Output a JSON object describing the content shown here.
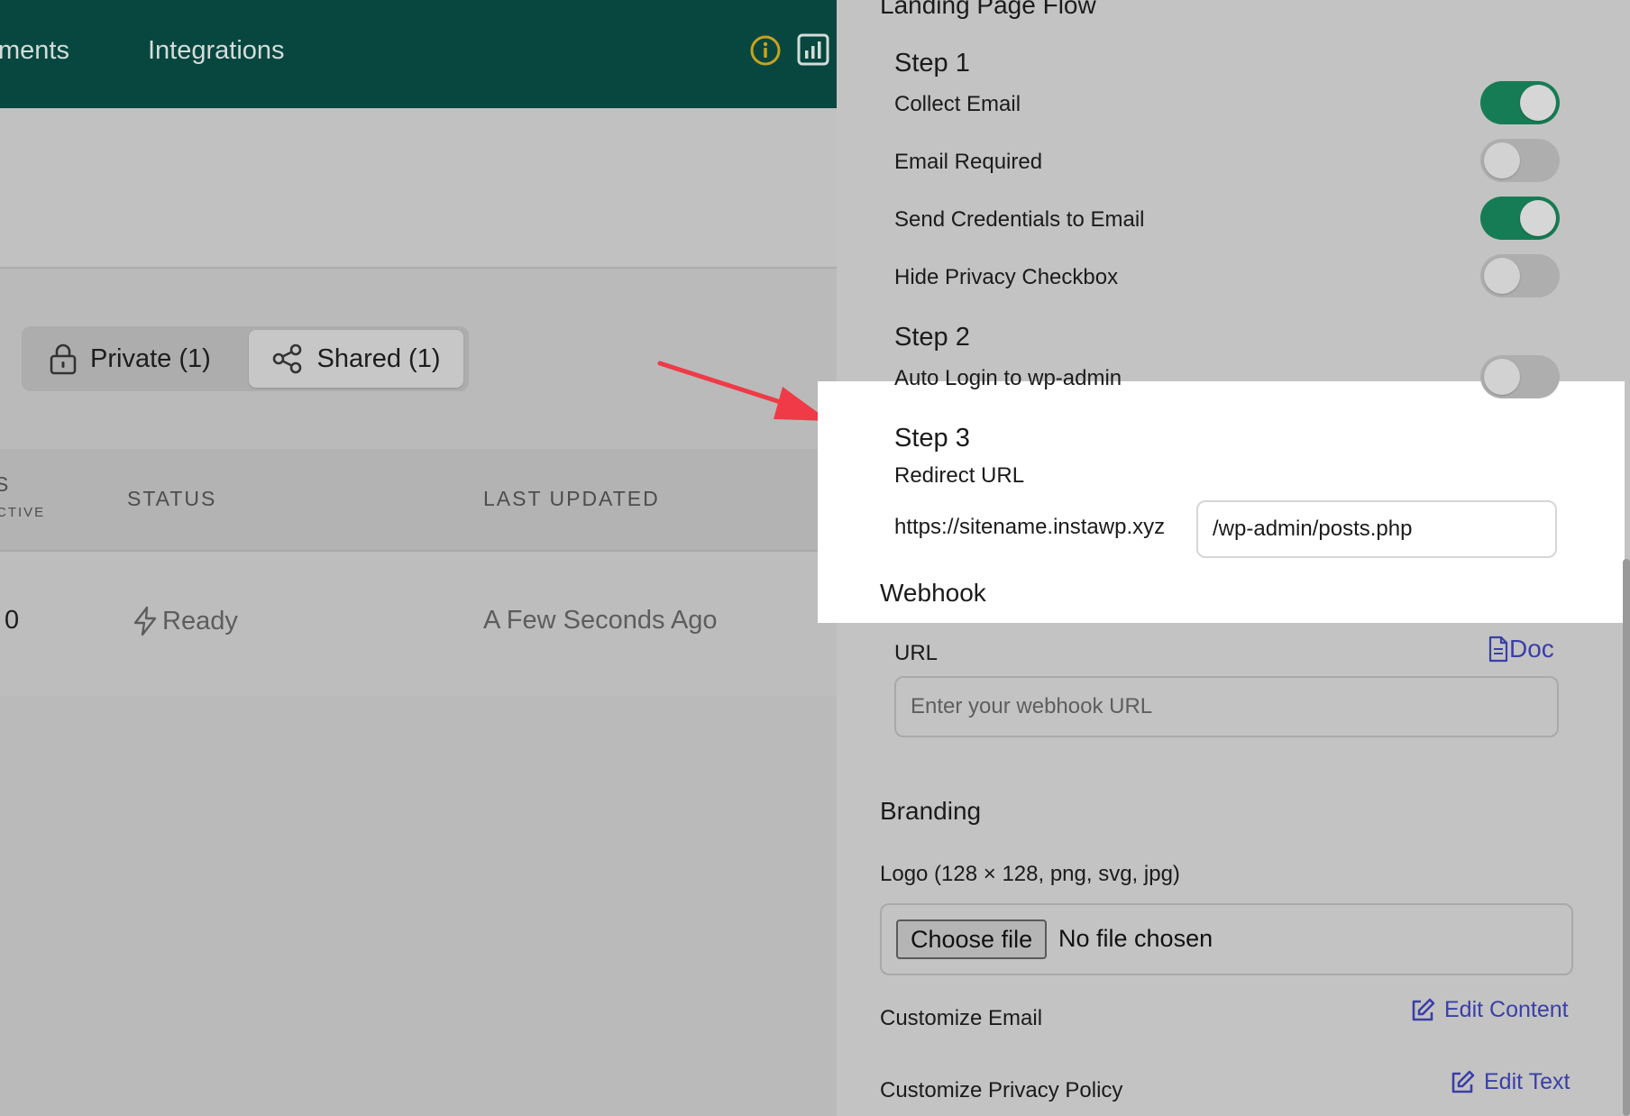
{
  "nav": {
    "items": [
      {
        "label": "ments"
      },
      {
        "label": "Integrations"
      }
    ]
  },
  "tabs": {
    "private": "Private (1)",
    "shared": "Shared (1)"
  },
  "table": {
    "headers": {
      "partial_s": "S",
      "partial_ctive": "CTIVE",
      "status": "STATUS",
      "last_updated": "LAST UPDATED"
    },
    "row": {
      "count": "0",
      "status": "Ready",
      "last_updated": "A Few Seconds Ago"
    }
  },
  "drawer": {
    "landing_title": "Landing Page Flow",
    "step1": {
      "title": "Step 1",
      "options": [
        {
          "label": "Collect Email",
          "on": true
        },
        {
          "label": "Email Required",
          "on": false
        },
        {
          "label": "Send Credentials to Email",
          "on": true
        },
        {
          "label": "Hide Privacy Checkbox",
          "on": false
        }
      ]
    },
    "step2": {
      "title": "Step 2",
      "options": [
        {
          "label": "Auto Login to wp-admin",
          "on": false
        }
      ]
    },
    "step3": {
      "title": "Step 3",
      "redirect_label": "Redirect URL",
      "url_prefix": "https://sitename.instawp.xyz",
      "url_path": "/wp-admin/posts.php"
    },
    "webhook": {
      "title": "Webhook",
      "url_label": "URL",
      "doc_label": "Doc",
      "placeholder": "Enter your webhook URL"
    },
    "branding": {
      "title": "Branding",
      "logo_label": "Logo (128 × 128, png, svg, jpg)",
      "choose_file": "Choose file",
      "no_file": "No file chosen",
      "customize_email": "Customize Email",
      "edit_content": "Edit Content",
      "customize_privacy": "Customize Privacy Policy",
      "edit_text": "Edit Text"
    }
  },
  "colors": {
    "brand_dark_green": "#074740",
    "toggle_on": "#167c55",
    "link": "#3a3fa8",
    "arrow": "#f03a47",
    "info_icon": "#c9a21e"
  }
}
